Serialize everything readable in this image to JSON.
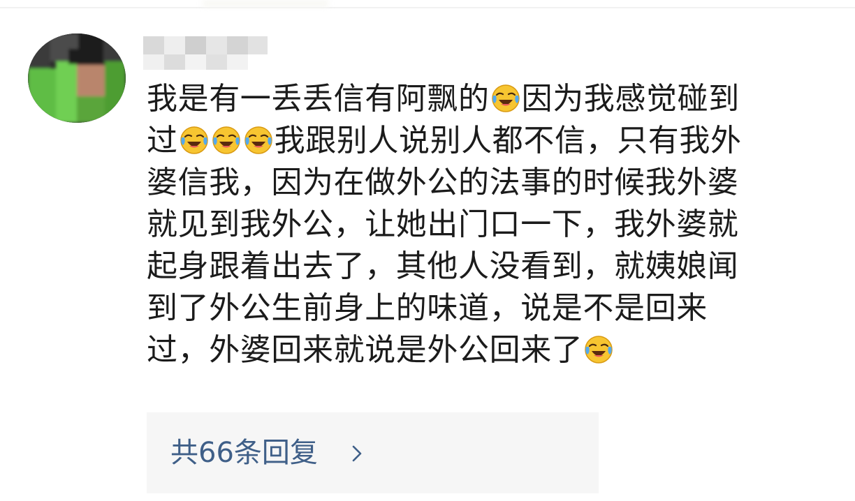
{
  "comment": {
    "lines": [
      [
        {
          "t": "text",
          "v": "我是有一丢丢信有阿飘的"
        },
        {
          "t": "emoji",
          "name": "laughing-crying-emoji"
        },
        {
          "t": "text",
          "v": "因为我感觉碰到"
        }
      ],
      [
        {
          "t": "text",
          "v": "过"
        },
        {
          "t": "emoji",
          "name": "laughing-crying-emoji"
        },
        {
          "t": "emoji",
          "name": "laughing-crying-emoji"
        },
        {
          "t": "emoji",
          "name": "laughing-crying-emoji"
        },
        {
          "t": "text",
          "v": "我跟别人说别人都不信，只有我外"
        }
      ],
      [
        {
          "t": "text",
          "v": "婆信我，因为在做外公的法事的时候我外婆"
        }
      ],
      [
        {
          "t": "text",
          "v": "就见到我外公，让她出门口一下，我外婆就"
        }
      ],
      [
        {
          "t": "text",
          "v": "起身跟着出去了，其他人没看到，就姨娘闻"
        }
      ],
      [
        {
          "t": "text",
          "v": "到了外公生前身上的味道，说是不是回来"
        }
      ],
      [
        {
          "t": "text",
          "v": "过，外婆回来就说是外公回来了"
        },
        {
          "t": "emoji",
          "name": "laughing-crying-emoji"
        }
      ]
    ]
  },
  "replies": {
    "label": "共66条回复",
    "icon": "chevron-right-icon"
  },
  "colors": {
    "text": "#1b1b1b",
    "link": "#3f5f88",
    "reply_bg": "#f6f6f6"
  }
}
